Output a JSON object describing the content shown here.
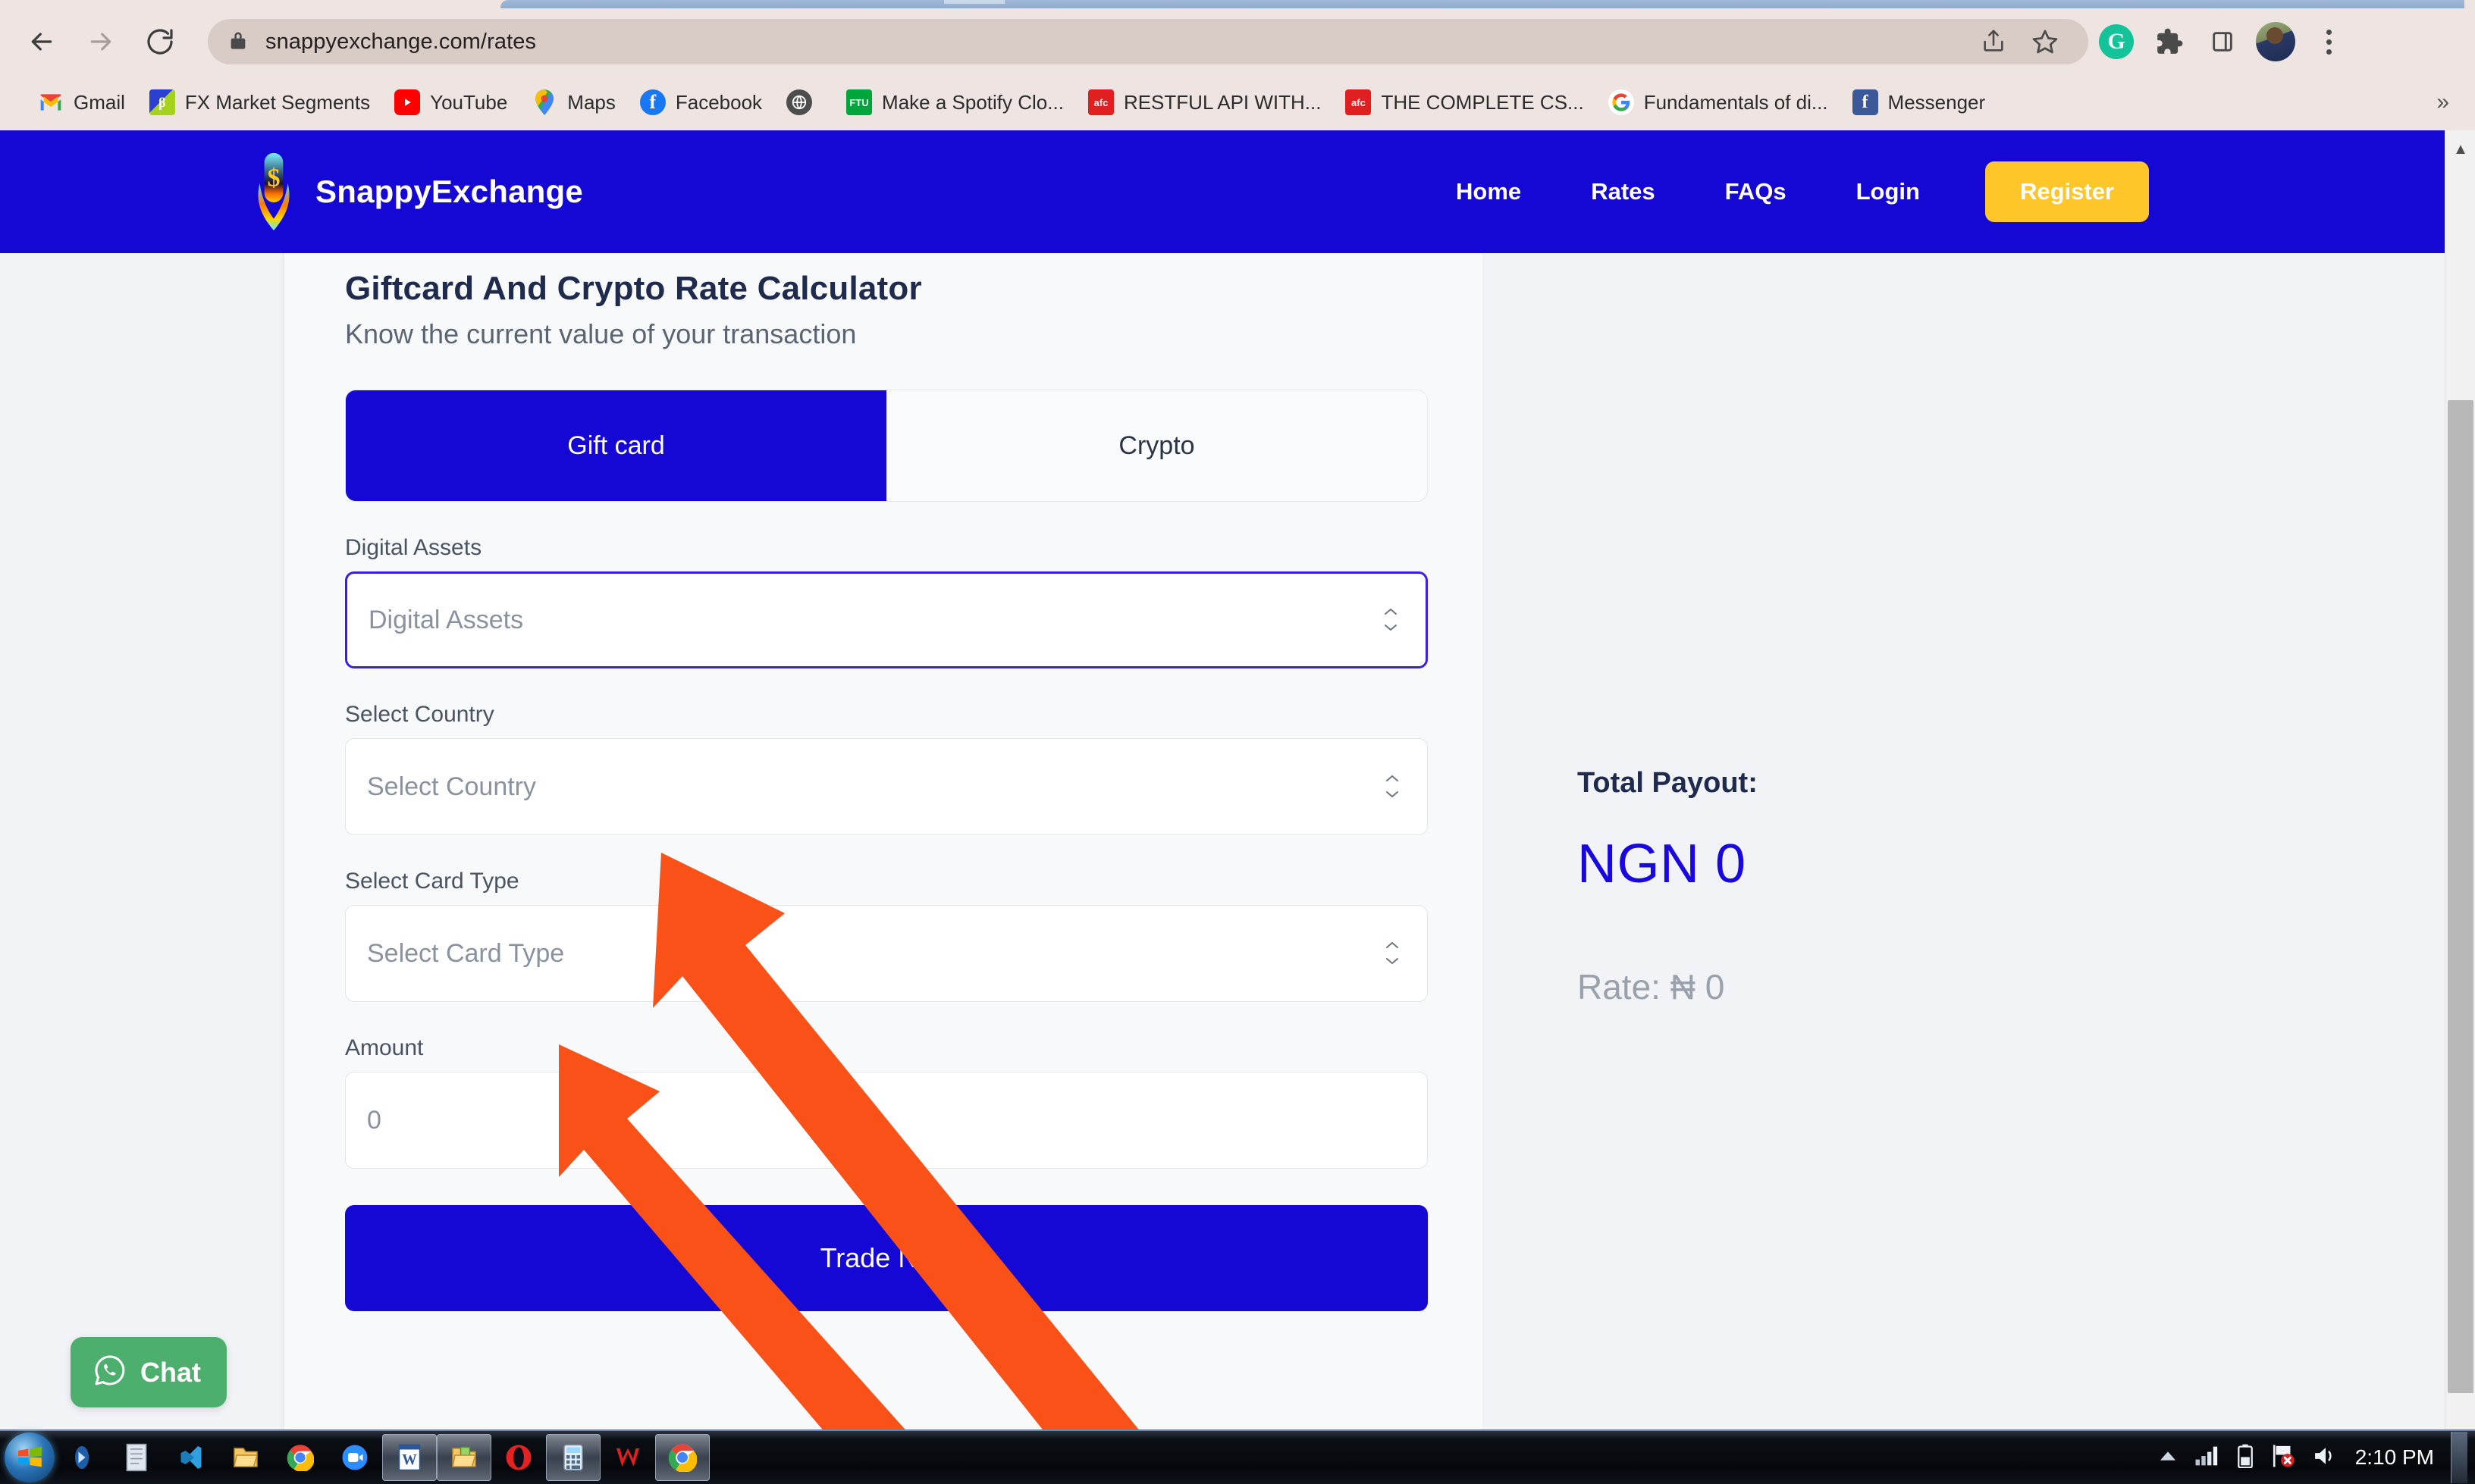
{
  "browser": {
    "url": "snappyexchange.com/rates",
    "nav": {
      "back": "back-arrow-icon",
      "forward": "forward-arrow-icon",
      "reload": "reload-icon",
      "lock": "lock-icon"
    },
    "omnibox_actions": [
      "share-icon",
      "star-bookmark-icon"
    ],
    "toolbar_extensions": [
      "grammarly-icon",
      "extensions-puzzle-icon",
      "side-panel-icon",
      "profile-avatar",
      "chrome-menu-icon"
    ],
    "grammarly_letter": "G",
    "bookmarks": [
      {
        "label": "Gmail",
        "icon": "gmail-icon"
      },
      {
        "label": "FX Market Segments",
        "icon": "fx-market-icon"
      },
      {
        "label": "YouTube",
        "icon": "youtube-icon"
      },
      {
        "label": "Maps",
        "icon": "google-maps-icon"
      },
      {
        "label": "Facebook",
        "icon": "facebook-icon"
      },
      {
        "label": "",
        "icon": "globe-dark-icon"
      },
      {
        "label": "Make a Spotify Clo...",
        "icon": "ftu-green-icon",
        "icon_text": "FTU"
      },
      {
        "label": "RESTFUL API WITH...",
        "icon": "afc-red-icon",
        "icon_text": "afc"
      },
      {
        "label": "THE COMPLETE CS...",
        "icon": "afc-red-icon",
        "icon_text": "afc"
      },
      {
        "label": "Fundamentals of di...",
        "icon": "google-icon"
      },
      {
        "label": "Messenger",
        "icon": "facebook-messenger-icon"
      }
    ],
    "bookmarks_overflow": "»"
  },
  "site": {
    "brand": "SnappyExchange",
    "brand_logo": "snappyexchange-logo-icon",
    "nav_links": [
      "Home",
      "Rates",
      "FAQs",
      "Login"
    ],
    "register_label": "Register",
    "colors": {
      "primary_blue": "#1507d4",
      "accent_yellow": "#ffc629",
      "payout_blue": "#1907e0",
      "whatsapp_green": "#4caf6d"
    }
  },
  "calculator": {
    "title": "Giftcard And Crypto Rate Calculator",
    "subtitle": "Know the current value of your transaction",
    "tabs": [
      {
        "label": "Gift card",
        "active": true
      },
      {
        "label": "Crypto",
        "active": false
      }
    ],
    "fields": [
      {
        "label": "Digital Assets",
        "value": "Digital Assets",
        "type": "select",
        "focused": true
      },
      {
        "label": "Select Country",
        "value": "Select Country",
        "type": "select",
        "focused": false
      },
      {
        "label": "Select Card Type",
        "value": "Select Card Type",
        "type": "select",
        "focused": false
      },
      {
        "label": "Amount",
        "value": "0",
        "type": "number",
        "focused": false
      }
    ],
    "submit_label": "Trade Now"
  },
  "payout": {
    "label": "Total Payout:",
    "amount": "NGN 0",
    "rate": "Rate: ₦ 0"
  },
  "chat": {
    "label": "Chat",
    "icon": "whatsapp-icon"
  },
  "taskbar": {
    "start": "windows-start-orb",
    "items": [
      {
        "name": "media-player-icon",
        "running": false
      },
      {
        "name": "notepad-icon",
        "running": false
      },
      {
        "name": "vscode-icon",
        "running": false
      },
      {
        "name": "file-explorer-icon",
        "running": false
      },
      {
        "name": "chrome-icon",
        "running": false
      },
      {
        "name": "zoom-icon",
        "running": false
      },
      {
        "name": "word-icon",
        "running": true
      },
      {
        "name": "folder-icon",
        "running": true
      },
      {
        "name": "opera-icon",
        "running": false
      },
      {
        "name": "calculator-icon",
        "running": true
      },
      {
        "name": "wondershare-icon",
        "running": false
      },
      {
        "name": "chrome-active-icon",
        "running": true
      }
    ],
    "tray": [
      "show-hidden-icons",
      "signal-bars-icon",
      "battery-icon",
      "action-center-flag-icon",
      "volume-icon"
    ],
    "clock": "2:10 PM"
  }
}
